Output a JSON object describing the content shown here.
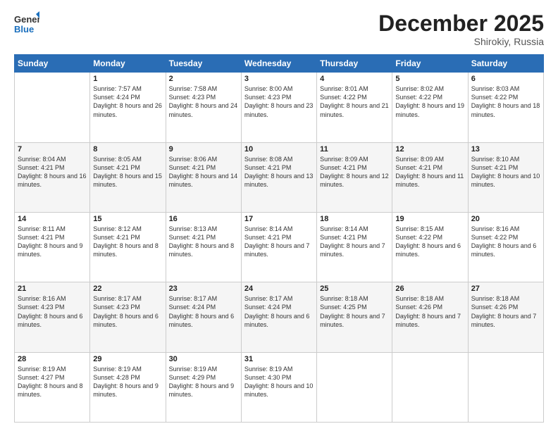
{
  "header": {
    "logo_line1": "General",
    "logo_line2": "Blue",
    "month": "December 2025",
    "location": "Shirokiy, Russia"
  },
  "weekdays": [
    "Sunday",
    "Monday",
    "Tuesday",
    "Wednesday",
    "Thursday",
    "Friday",
    "Saturday"
  ],
  "weeks": [
    [
      {
        "day": "",
        "sunrise": "",
        "sunset": "",
        "daylight": ""
      },
      {
        "day": "1",
        "sunrise": "Sunrise: 7:57 AM",
        "sunset": "Sunset: 4:24 PM",
        "daylight": "Daylight: 8 hours and 26 minutes."
      },
      {
        "day": "2",
        "sunrise": "Sunrise: 7:58 AM",
        "sunset": "Sunset: 4:23 PM",
        "daylight": "Daylight: 8 hours and 24 minutes."
      },
      {
        "day": "3",
        "sunrise": "Sunrise: 8:00 AM",
        "sunset": "Sunset: 4:23 PM",
        "daylight": "Daylight: 8 hours and 23 minutes."
      },
      {
        "day": "4",
        "sunrise": "Sunrise: 8:01 AM",
        "sunset": "Sunset: 4:22 PM",
        "daylight": "Daylight: 8 hours and 21 minutes."
      },
      {
        "day": "5",
        "sunrise": "Sunrise: 8:02 AM",
        "sunset": "Sunset: 4:22 PM",
        "daylight": "Daylight: 8 hours and 19 minutes."
      },
      {
        "day": "6",
        "sunrise": "Sunrise: 8:03 AM",
        "sunset": "Sunset: 4:22 PM",
        "daylight": "Daylight: 8 hours and 18 minutes."
      }
    ],
    [
      {
        "day": "7",
        "sunrise": "Sunrise: 8:04 AM",
        "sunset": "Sunset: 4:21 PM",
        "daylight": "Daylight: 8 hours and 16 minutes."
      },
      {
        "day": "8",
        "sunrise": "Sunrise: 8:05 AM",
        "sunset": "Sunset: 4:21 PM",
        "daylight": "Daylight: 8 hours and 15 minutes."
      },
      {
        "day": "9",
        "sunrise": "Sunrise: 8:06 AM",
        "sunset": "Sunset: 4:21 PM",
        "daylight": "Daylight: 8 hours and 14 minutes."
      },
      {
        "day": "10",
        "sunrise": "Sunrise: 8:08 AM",
        "sunset": "Sunset: 4:21 PM",
        "daylight": "Daylight: 8 hours and 13 minutes."
      },
      {
        "day": "11",
        "sunrise": "Sunrise: 8:09 AM",
        "sunset": "Sunset: 4:21 PM",
        "daylight": "Daylight: 8 hours and 12 minutes."
      },
      {
        "day": "12",
        "sunrise": "Sunrise: 8:09 AM",
        "sunset": "Sunset: 4:21 PM",
        "daylight": "Daylight: 8 hours and 11 minutes."
      },
      {
        "day": "13",
        "sunrise": "Sunrise: 8:10 AM",
        "sunset": "Sunset: 4:21 PM",
        "daylight": "Daylight: 8 hours and 10 minutes."
      }
    ],
    [
      {
        "day": "14",
        "sunrise": "Sunrise: 8:11 AM",
        "sunset": "Sunset: 4:21 PM",
        "daylight": "Daylight: 8 hours and 9 minutes."
      },
      {
        "day": "15",
        "sunrise": "Sunrise: 8:12 AM",
        "sunset": "Sunset: 4:21 PM",
        "daylight": "Daylight: 8 hours and 8 minutes."
      },
      {
        "day": "16",
        "sunrise": "Sunrise: 8:13 AM",
        "sunset": "Sunset: 4:21 PM",
        "daylight": "Daylight: 8 hours and 8 minutes."
      },
      {
        "day": "17",
        "sunrise": "Sunrise: 8:14 AM",
        "sunset": "Sunset: 4:21 PM",
        "daylight": "Daylight: 8 hours and 7 minutes."
      },
      {
        "day": "18",
        "sunrise": "Sunrise: 8:14 AM",
        "sunset": "Sunset: 4:21 PM",
        "daylight": "Daylight: 8 hours and 7 minutes."
      },
      {
        "day": "19",
        "sunrise": "Sunrise: 8:15 AM",
        "sunset": "Sunset: 4:22 PM",
        "daylight": "Daylight: 8 hours and 6 minutes."
      },
      {
        "day": "20",
        "sunrise": "Sunrise: 8:16 AM",
        "sunset": "Sunset: 4:22 PM",
        "daylight": "Daylight: 8 hours and 6 minutes."
      }
    ],
    [
      {
        "day": "21",
        "sunrise": "Sunrise: 8:16 AM",
        "sunset": "Sunset: 4:23 PM",
        "daylight": "Daylight: 8 hours and 6 minutes."
      },
      {
        "day": "22",
        "sunrise": "Sunrise: 8:17 AM",
        "sunset": "Sunset: 4:23 PM",
        "daylight": "Daylight: 8 hours and 6 minutes."
      },
      {
        "day": "23",
        "sunrise": "Sunrise: 8:17 AM",
        "sunset": "Sunset: 4:24 PM",
        "daylight": "Daylight: 8 hours and 6 minutes."
      },
      {
        "day": "24",
        "sunrise": "Sunrise: 8:17 AM",
        "sunset": "Sunset: 4:24 PM",
        "daylight": "Daylight: 8 hours and 6 minutes."
      },
      {
        "day": "25",
        "sunrise": "Sunrise: 8:18 AM",
        "sunset": "Sunset: 4:25 PM",
        "daylight": "Daylight: 8 hours and 7 minutes."
      },
      {
        "day": "26",
        "sunrise": "Sunrise: 8:18 AM",
        "sunset": "Sunset: 4:26 PM",
        "daylight": "Daylight: 8 hours and 7 minutes."
      },
      {
        "day": "27",
        "sunrise": "Sunrise: 8:18 AM",
        "sunset": "Sunset: 4:26 PM",
        "daylight": "Daylight: 8 hours and 7 minutes."
      }
    ],
    [
      {
        "day": "28",
        "sunrise": "Sunrise: 8:19 AM",
        "sunset": "Sunset: 4:27 PM",
        "daylight": "Daylight: 8 hours and 8 minutes."
      },
      {
        "day": "29",
        "sunrise": "Sunrise: 8:19 AM",
        "sunset": "Sunset: 4:28 PM",
        "daylight": "Daylight: 8 hours and 9 minutes."
      },
      {
        "day": "30",
        "sunrise": "Sunrise: 8:19 AM",
        "sunset": "Sunset: 4:29 PM",
        "daylight": "Daylight: 8 hours and 9 minutes."
      },
      {
        "day": "31",
        "sunrise": "Sunrise: 8:19 AM",
        "sunset": "Sunset: 4:30 PM",
        "daylight": "Daylight: 8 hours and 10 minutes."
      },
      {
        "day": "",
        "sunrise": "",
        "sunset": "",
        "daylight": ""
      },
      {
        "day": "",
        "sunrise": "",
        "sunset": "",
        "daylight": ""
      },
      {
        "day": "",
        "sunrise": "",
        "sunset": "",
        "daylight": ""
      }
    ]
  ]
}
